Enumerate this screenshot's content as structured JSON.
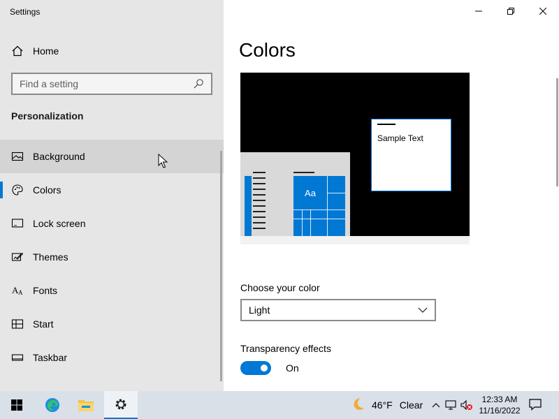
{
  "window": {
    "app_title": "Settings",
    "caption": {
      "minimize": "minimize",
      "restore": "restore",
      "close": "close"
    }
  },
  "sidebar": {
    "home_label": "Home",
    "search_placeholder": "Find a setting",
    "section_heading": "Personalization",
    "items": [
      {
        "label": "Background",
        "icon": "image-icon",
        "state": "hover"
      },
      {
        "label": "Colors",
        "icon": "palette-icon",
        "state": "selected"
      },
      {
        "label": "Lock screen",
        "icon": "lock-screen-icon",
        "state": "normal"
      },
      {
        "label": "Themes",
        "icon": "themes-icon",
        "state": "normal"
      },
      {
        "label": "Fonts",
        "icon": "fonts-icon",
        "state": "normal"
      },
      {
        "label": "Start",
        "icon": "start-icon",
        "state": "normal"
      },
      {
        "label": "Taskbar",
        "icon": "taskbar-icon",
        "state": "normal"
      }
    ]
  },
  "main": {
    "page_title": "Colors",
    "preview": {
      "sample_text": "Sample Text",
      "tile_text": "Aa"
    },
    "choose_color_label": "Choose your color",
    "choose_color_value": "Light",
    "transparency_label": "Transparency effects",
    "transparency_state": "On"
  },
  "taskbar": {
    "weather_temp": "46°F",
    "weather_condition": "Clear",
    "time": "12:33 AM",
    "date": "11/16/2022"
  },
  "colors": {
    "accent": "#0078d4",
    "sidebar_bg": "#e6e6e6",
    "taskbar_bg": "#d9e0e8"
  }
}
